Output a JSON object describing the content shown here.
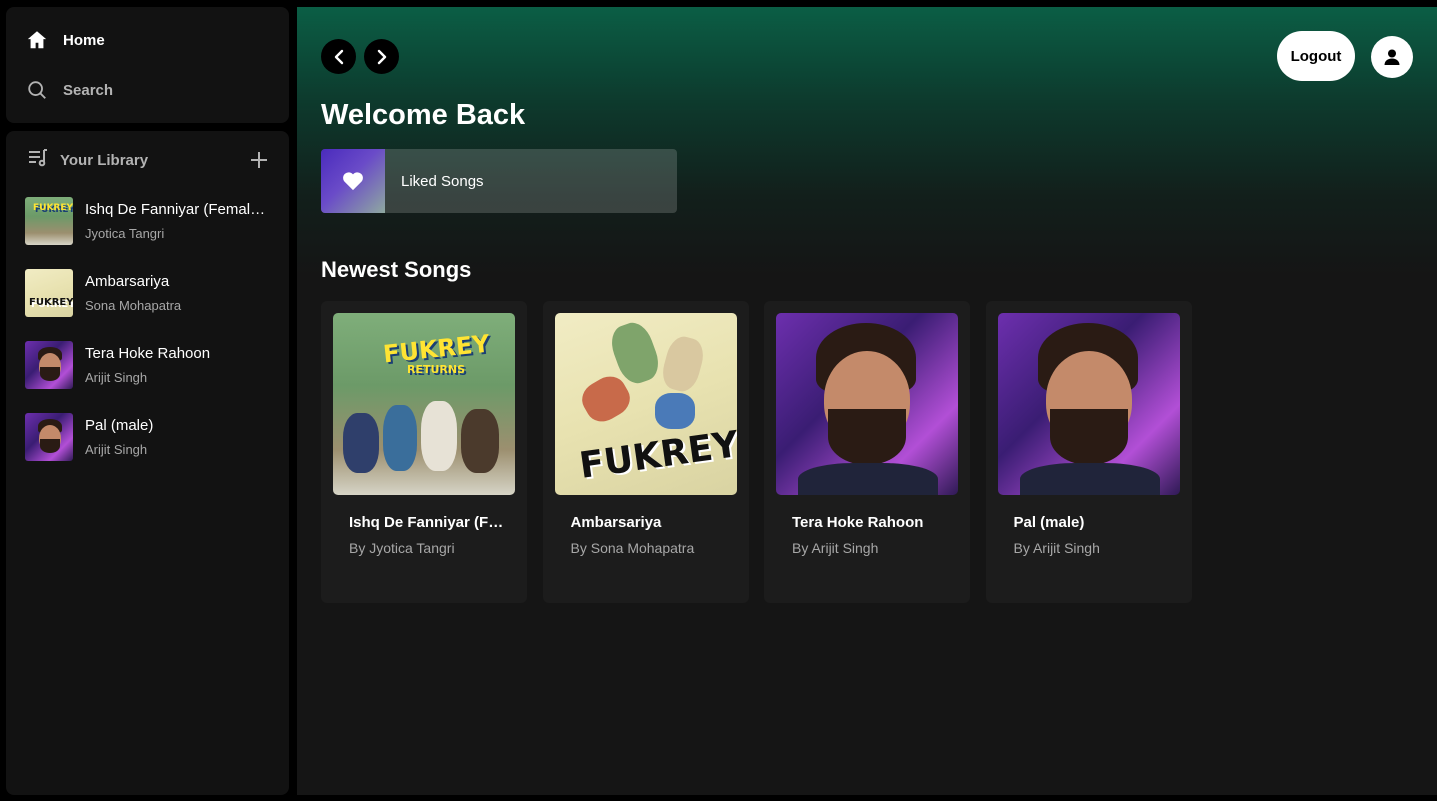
{
  "sidebar": {
    "nav": {
      "home_label": "Home",
      "search_label": "Search"
    },
    "library": {
      "title": "Your Library",
      "items": [
        {
          "title": "Ishq De Fanniyar (Female Version)",
          "artist": "Jyotica Tangri",
          "art": "fukrey-returns"
        },
        {
          "title": "Ambarsariya",
          "artist": "Sona Mohapatra",
          "art": "fukrey"
        },
        {
          "title": "Tera Hoke Rahoon",
          "artist": "Arijit Singh",
          "art": "arijit"
        },
        {
          "title": "Pal (male)",
          "artist": "Arijit Singh",
          "art": "arijit"
        }
      ]
    }
  },
  "header": {
    "logout_label": "Logout"
  },
  "main": {
    "welcome": "Welcome Back",
    "liked_songs_label": "Liked Songs",
    "newest_title": "Newest Songs",
    "cards": [
      {
        "title": "Ishq De Fanniyar (Female Version)",
        "artist": "By Jyotica Tangri",
        "art": "fukrey-returns"
      },
      {
        "title": "Ambarsariya",
        "artist": "By Sona Mohapatra",
        "art": "fukrey"
      },
      {
        "title": "Tera Hoke Rahoon",
        "artist": "By Arijit Singh",
        "art": "arijit"
      },
      {
        "title": "Pal (male)",
        "artist": "By Arijit Singh",
        "art": "arijit"
      }
    ],
    "art_text": {
      "fukrey_returns_top": "FUKREY",
      "fukrey_returns_bottom": "RETURNS",
      "fukrey": "FUKREY"
    }
  },
  "colors": {
    "accent_green": "#0b5e45",
    "panel_bg": "#121212",
    "card_bg": "#1c1c1c",
    "muted_text": "#a7a7a7"
  },
  "icons": [
    "home-icon",
    "search-icon",
    "library-icon",
    "plus-icon",
    "chevron-left-icon",
    "chevron-right-icon",
    "user-icon",
    "heart-icon"
  ]
}
